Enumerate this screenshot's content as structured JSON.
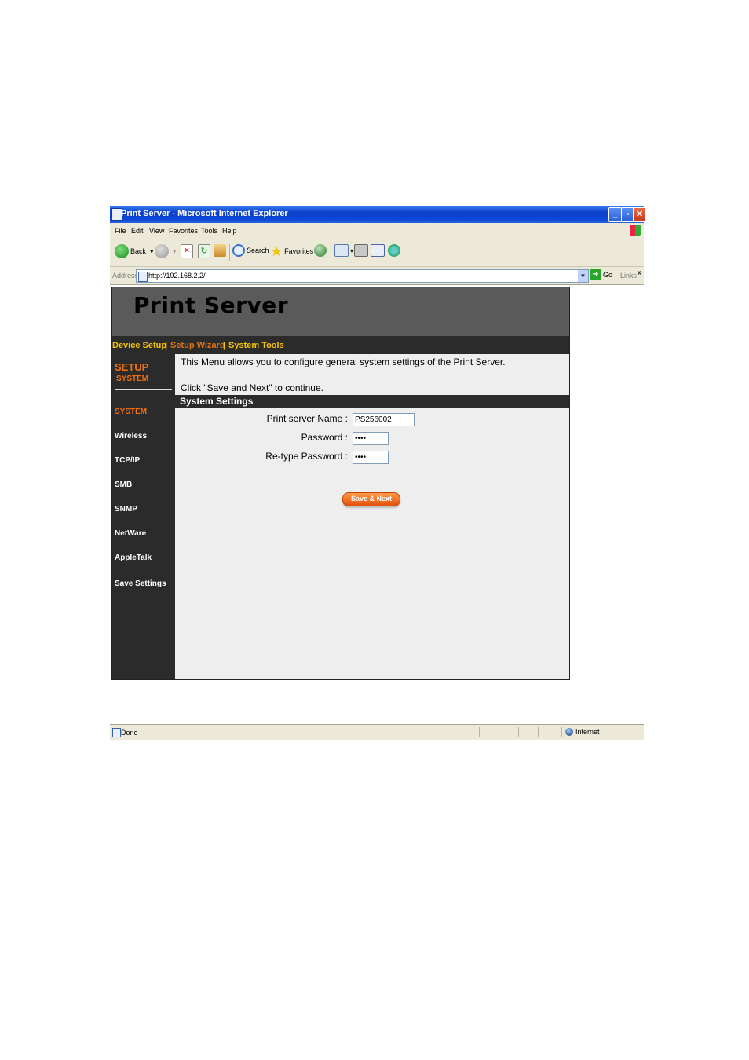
{
  "window": {
    "title": "Print Server - Microsoft Internet Explorer"
  },
  "menubar": [
    "File",
    "Edit",
    "View",
    "Favorites",
    "Tools",
    "Help"
  ],
  "toolbar": {
    "back": "Back",
    "search": "Search",
    "favorites": "Favorites"
  },
  "address": {
    "label": "Address",
    "url": "http://192.168.2.2/",
    "go": "Go",
    "links": "Links"
  },
  "page": {
    "brand": "Print Server",
    "topnav": [
      "Device Setup",
      "Setup Wizard",
      "System Tools"
    ],
    "sidebar": {
      "heading": "SETUP",
      "subheading": "SYSTEM",
      "items": [
        "SYSTEM",
        "Wireless",
        "TCP/IP",
        "SMB",
        "SNMP",
        "NetWare",
        "AppleTalk",
        "Save Settings"
      ]
    },
    "intro": "This Menu allows you to configure general system settings of the Print Server.",
    "continue_note": "Click \"Save and Next\" to continue.",
    "section_title": "System Settings",
    "form": {
      "server_name_label": "Print server Name :",
      "server_name_value": "PS256002",
      "password_label": "Password :",
      "password_value": "••••",
      "retype_label": "Re-type Password :",
      "retype_value": "••••"
    },
    "save_button": "Save & Next"
  },
  "status": {
    "text": "Done",
    "zone": "Internet"
  }
}
